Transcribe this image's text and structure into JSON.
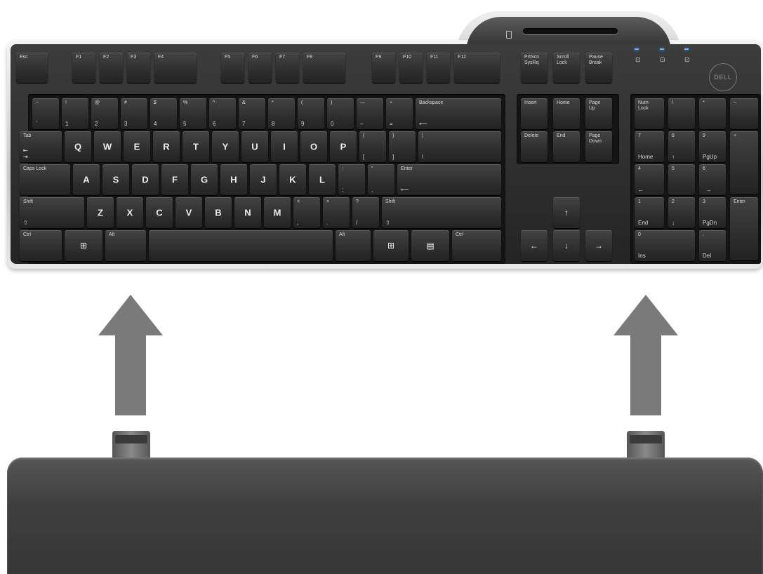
{
  "keyboard": {
    "brand": "DELL",
    "keys": [
      {
        "id": "esc",
        "t": "Esc"
      },
      {
        "id": "f1",
        "t": "F1"
      },
      {
        "id": "f2",
        "t": "F2"
      },
      {
        "id": "f3",
        "t": "F3"
      },
      {
        "id": "f4",
        "t": "F4"
      },
      {
        "id": "f5",
        "t": "F5"
      },
      {
        "id": "f6",
        "t": "F6"
      },
      {
        "id": "f7",
        "t": "F7"
      },
      {
        "id": "f8",
        "t": "F8"
      },
      {
        "id": "f9",
        "t": "F9"
      },
      {
        "id": "f10",
        "t": "F10"
      },
      {
        "id": "f11",
        "t": "F11"
      },
      {
        "id": "f12",
        "t": "F12"
      },
      {
        "id": "prtscn",
        "t": "PrtScn\nSysRq"
      },
      {
        "id": "scroll",
        "t": "Scroll\nLock"
      },
      {
        "id": "pause",
        "t": "Pause\nBreak"
      },
      {
        "id": "tilde",
        "t": "~",
        "b": "`"
      },
      {
        "id": "k1",
        "t": "!",
        "b": "1"
      },
      {
        "id": "k2",
        "t": "@",
        "b": "2"
      },
      {
        "id": "k3",
        "t": "#",
        "b": "3"
      },
      {
        "id": "k4",
        "t": "$",
        "b": "4"
      },
      {
        "id": "k5",
        "t": "%",
        "b": "5"
      },
      {
        "id": "k6",
        "t": "^",
        "b": "6"
      },
      {
        "id": "k7",
        "t": "&",
        "b": "7"
      },
      {
        "id": "k8",
        "t": "*",
        "b": "8"
      },
      {
        "id": "k9",
        "t": "(",
        "b": "9"
      },
      {
        "id": "k0",
        "t": ")",
        "b": "0"
      },
      {
        "id": "minus",
        "t": "—",
        "b": "–"
      },
      {
        "id": "plus",
        "t": "+",
        "b": "="
      },
      {
        "id": "backspace",
        "t": "Backspace",
        "b": "⟵"
      },
      {
        "id": "insert",
        "t": "Insert"
      },
      {
        "id": "home",
        "t": "Home"
      },
      {
        "id": "pageup",
        "t": "Page\nUp"
      },
      {
        "id": "numlock",
        "t": "Num\nLock"
      },
      {
        "id": "npdiv",
        "t": "/"
      },
      {
        "id": "npmul",
        "t": "*"
      },
      {
        "id": "npminus",
        "t": "–"
      },
      {
        "id": "tab",
        "t": "Tab",
        "b": "⇤\n⇥"
      },
      {
        "id": "q",
        "big": "Q"
      },
      {
        "id": "w",
        "big": "W"
      },
      {
        "id": "e",
        "big": "E"
      },
      {
        "id": "r",
        "big": "R"
      },
      {
        "id": "tk",
        "big": "T"
      },
      {
        "id": "y",
        "big": "Y"
      },
      {
        "id": "u",
        "big": "U"
      },
      {
        "id": "i",
        "big": "I"
      },
      {
        "id": "o",
        "big": "O"
      },
      {
        "id": "p",
        "big": "P"
      },
      {
        "id": "lbrace",
        "t": "{",
        "b": "["
      },
      {
        "id": "rbrace",
        "t": "}",
        "b": "]"
      },
      {
        "id": "pipe",
        "t": "¦",
        "b": "\\"
      },
      {
        "id": "delete",
        "t": "Delete"
      },
      {
        "id": "end",
        "t": "End"
      },
      {
        "id": "pagedown",
        "t": "Page\nDown"
      },
      {
        "id": "np7",
        "t": "7",
        "b": "Home"
      },
      {
        "id": "np8",
        "t": "8",
        "b": "↑"
      },
      {
        "id": "np9",
        "t": "9",
        "b": "PgUp"
      },
      {
        "id": "npplus",
        "t": "+"
      },
      {
        "id": "caps",
        "t": "Caps Lock"
      },
      {
        "id": "a",
        "big": "A"
      },
      {
        "id": "s",
        "big": "S"
      },
      {
        "id": "d",
        "big": "D"
      },
      {
        "id": "f",
        "big": "F"
      },
      {
        "id": "g",
        "big": "G"
      },
      {
        "id": "h",
        "big": "H"
      },
      {
        "id": "j",
        "big": "J"
      },
      {
        "id": "kk",
        "big": "K"
      },
      {
        "id": "l",
        "big": "L"
      },
      {
        "id": "colon",
        "t": ":",
        "b": ";"
      },
      {
        "id": "quote",
        "t": "\"",
        "b": ","
      },
      {
        "id": "enter",
        "t": "Enter",
        "b": "⟵"
      },
      {
        "id": "np4",
        "t": "4",
        "b": "←"
      },
      {
        "id": "np5",
        "t": "5"
      },
      {
        "id": "np6",
        "t": "6",
        "b": "  →"
      },
      {
        "id": "lshift",
        "t": "Shift",
        "b": "⇧"
      },
      {
        "id": "z",
        "big": "Z"
      },
      {
        "id": "x",
        "big": "X"
      },
      {
        "id": "cc",
        "big": "C"
      },
      {
        "id": "v",
        "big": "V"
      },
      {
        "id": "bk",
        "big": "B"
      },
      {
        "id": "n",
        "big": "N"
      },
      {
        "id": "m",
        "big": "M"
      },
      {
        "id": "comma",
        "t": "<",
        "b": ","
      },
      {
        "id": "period",
        "t": ">",
        "b": "."
      },
      {
        "id": "slash",
        "t": "?",
        "b": "/"
      },
      {
        "id": "rshift",
        "t": "Shift",
        "b": "⇧"
      },
      {
        "id": "up",
        "c": "↑"
      },
      {
        "id": "np1",
        "t": "1",
        "b": "End"
      },
      {
        "id": "np2",
        "t": "2",
        "b": "↓"
      },
      {
        "id": "np3",
        "t": "3",
        "b": "PgDn"
      },
      {
        "id": "npenter",
        "t": "Enter"
      },
      {
        "id": "lctrl",
        "t": "Ctrl"
      },
      {
        "id": "lwin",
        "c": "⊞"
      },
      {
        "id": "lalt",
        "t": "Alt"
      },
      {
        "id": "space"
      },
      {
        "id": "ralt",
        "t": "Alt"
      },
      {
        "id": "rwin",
        "c": "⊞"
      },
      {
        "id": "menu",
        "c": "▤"
      },
      {
        "id": "rctrl",
        "t": "Ctrl"
      },
      {
        "id": "left",
        "c": "←"
      },
      {
        "id": "down",
        "c": "↓"
      },
      {
        "id": "right",
        "c": "→"
      },
      {
        "id": "np0",
        "t": "0",
        "b": "Ins"
      },
      {
        "id": "npdel",
        "t": ".",
        "b": "Del"
      }
    ]
  },
  "colors": {
    "arrow": "#7a7a7a",
    "keycap": "#2e2e2e",
    "frame": "#d6d6d6",
    "led": "#6ab7ff"
  }
}
